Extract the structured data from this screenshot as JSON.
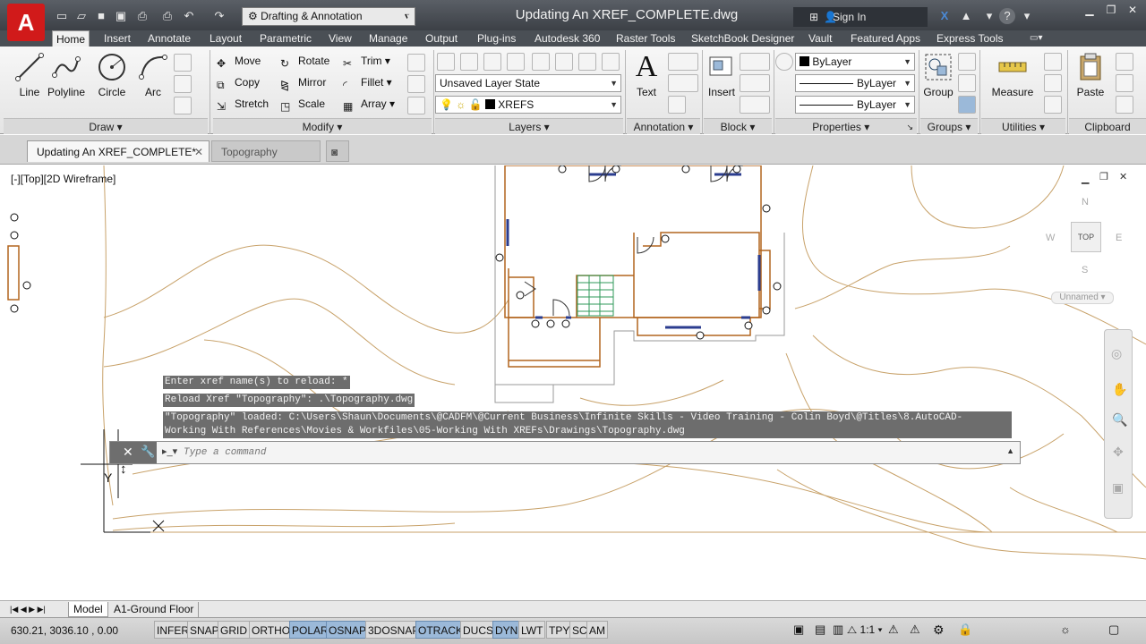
{
  "app": {
    "logo_letter": "A",
    "title": "Updating An XREF_COMPLETE.dwg",
    "brand_color": "#d11a1a"
  },
  "quick_access": {
    "workspace": "Drafting & Annotation",
    "search_icon": "binoculars-icon",
    "sign_in": "Sign In"
  },
  "ribbon_tabs": [
    "Home",
    "Insert",
    "Annotate",
    "Layout",
    "Parametric",
    "View",
    "Manage",
    "Output",
    "Plug-ins",
    "Autodesk 360",
    "Raster Tools",
    "SketchBook Designer",
    "Vault",
    "Featured Apps",
    "Express Tools"
  ],
  "draw": {
    "line": "Line",
    "polyline": "Polyline",
    "circle": "Circle",
    "arc": "Arc",
    "panel": "Draw"
  },
  "modify": {
    "move": "Move",
    "rotate": "Rotate",
    "trim": "Trim",
    "copy": "Copy",
    "mirror": "Mirror",
    "fillet": "Fillet",
    "stretch": "Stretch",
    "scale": "Scale",
    "array": "Array",
    "panel": "Modify"
  },
  "layers": {
    "layer_state": "Unsaved Layer State",
    "current_layer": "XREFS",
    "panel": "Layers"
  },
  "annotation": {
    "text": "Text",
    "panel": "Annotation"
  },
  "block": {
    "insert": "Insert",
    "panel": "Block"
  },
  "properties": {
    "color": "ByLayer",
    "linetype": "ByLayer",
    "lineweight": "ByLayer",
    "panel": "Properties"
  },
  "groups": {
    "group": "Group",
    "panel": "Groups"
  },
  "utilities": {
    "measure": "Measure",
    "panel": "Utilities"
  },
  "clipboard": {
    "paste": "Paste",
    "panel": "Clipboard"
  },
  "doc_tabs": [
    "Updating An XREF_COMPLETE*",
    "Topography"
  ],
  "viewport": {
    "label": "[-][Top][2D Wireframe]"
  },
  "viewcube": {
    "n": "N",
    "s": "S",
    "e": "E",
    "w": "W",
    "face": "TOP",
    "ucs": "Unnamed"
  },
  "command": {
    "history": [
      "Enter xref name(s) to reload: *",
      "Reload Xref \"Topography\": .\\Topography.dwg",
      "\"Topography\" loaded: C:\\Users\\Shaun\\Documents\\@CADFM\\@Current Business\\Infinite Skills - Video Training - Colin Boyd\\@Titles\\8.AutoCAD-",
      "Working With References\\Movies & Workfiles\\05-Working With XREFs\\Drawings\\Topography.dwg"
    ],
    "placeholder": "Type a command"
  },
  "ucs_icon": {
    "y": "Y",
    "x": "X"
  },
  "layout_tabs": [
    "Model",
    "A1-Ground Floor"
  ],
  "status": {
    "coords": "630.21, 3036.10 , 0.00",
    "toggles": [
      {
        "label": "INFER",
        "on": false
      },
      {
        "label": "SNAP",
        "on": false
      },
      {
        "label": "GRID",
        "on": false
      },
      {
        "label": "ORTHO",
        "on": false
      },
      {
        "label": "POLAR",
        "on": true
      },
      {
        "label": "OSNAP",
        "on": true
      },
      {
        "label": "3DOSNAP",
        "on": false
      },
      {
        "label": "OTRACK",
        "on": true
      },
      {
        "label": "DUCS",
        "on": false
      },
      {
        "label": "DYN",
        "on": true
      },
      {
        "label": "LWT",
        "on": false
      },
      {
        "label": "TPY",
        "on": false
      },
      {
        "label": "SC",
        "on": false
      },
      {
        "label": "AM",
        "on": false
      }
    ],
    "annotation_scale": "1:1"
  },
  "colors": {
    "contour": "#c8a26a",
    "walls": "#b2651e",
    "titlebar": "#474b51",
    "status_on": "#9bb9d9"
  }
}
